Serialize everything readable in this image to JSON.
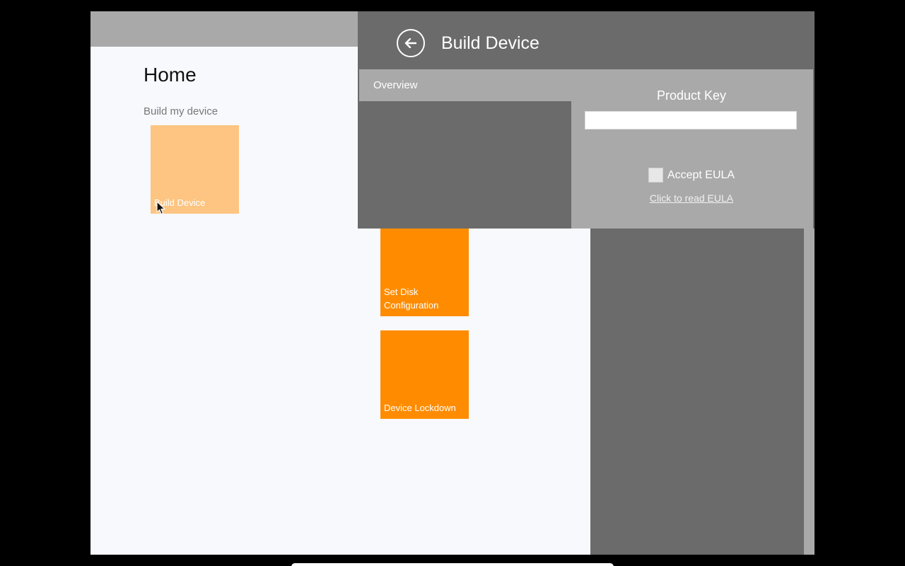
{
  "home": {
    "title": "Home",
    "section_label": "Build my device"
  },
  "tiles": [
    {
      "label": "Build Device",
      "color": "#fdc581",
      "state": "pressed"
    },
    {
      "label": "Set Disk Configuration",
      "color": "#ff8c00"
    },
    {
      "label": "Device Lockdown",
      "color": "#ff8c00"
    }
  ],
  "flyout": {
    "title": "Build Device",
    "back_icon": "back-arrow-icon",
    "tabs": [
      {
        "label": "Overview"
      }
    ],
    "form": {
      "product_key_label": "Product Key",
      "product_key_value": "",
      "accept_eula_label": "Accept EULA",
      "accept_eula_checked": false,
      "eula_link_text": "Click to read EULA"
    }
  },
  "colors": {
    "accent_orange": "#ff8c00",
    "panel_gray": "#6b6b6b",
    "light_gray": "#a9a9a9",
    "background": "#f7f9fc"
  }
}
